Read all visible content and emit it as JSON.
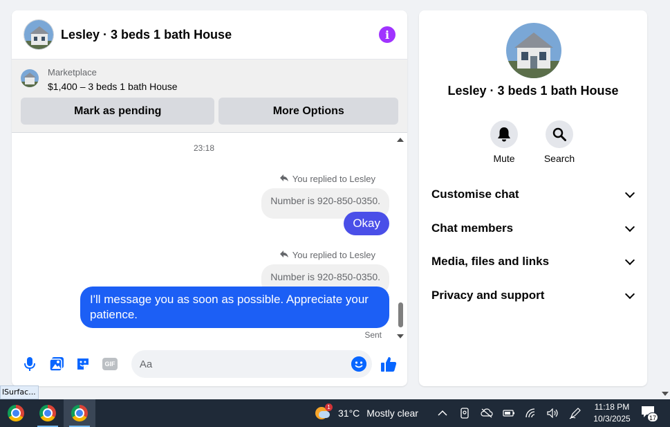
{
  "chat": {
    "title": "Lesley · 3 beds 1 bath House",
    "marketplace_label": "Marketplace",
    "listing": "$1,400 – 3 beds 1 bath House",
    "mark_pending_label": "Mark as pending",
    "more_options_label": "More Options",
    "timestamp": "23:18",
    "messages": [
      {
        "reply_label": "You replied to Lesley",
        "quoted": "Number is 920-850-0350.",
        "text": "Okay"
      },
      {
        "reply_label": "You replied to Lesley",
        "quoted": "Number is 920-850-0350.",
        "text": "I'll message you as soon as possible. Appreciate your patience."
      }
    ],
    "status": "Sent",
    "composer_placeholder": "Aa",
    "composer_icons": [
      "microphone-icon",
      "photo-icon",
      "sticker-icon",
      "gif-icon",
      "emoji-icon",
      "thumbs-up-icon"
    ],
    "gif_label": "GIF"
  },
  "info_panel": {
    "title": "Lesley · 3 beds 1 bath House",
    "actions": [
      {
        "label": "Mute",
        "icon": "bell-icon"
      },
      {
        "label": "Search",
        "icon": "search-icon"
      }
    ],
    "sections": [
      "Customise chat",
      "Chat members",
      "Media, files and links",
      "Privacy and support"
    ]
  },
  "tooltip": "lSurfac...",
  "taskbar": {
    "weather_badge": "1",
    "temperature": "31°C",
    "weather": "Mostly clear",
    "time": "11:18 PM",
    "date": "10/3/2025",
    "notification_count": "17"
  },
  "colors": {
    "accent": "#0866ff",
    "bubble_okay": "#4a4fe8",
    "bubble_long": "#1c5ff5",
    "info_icon": "#a033ff"
  }
}
